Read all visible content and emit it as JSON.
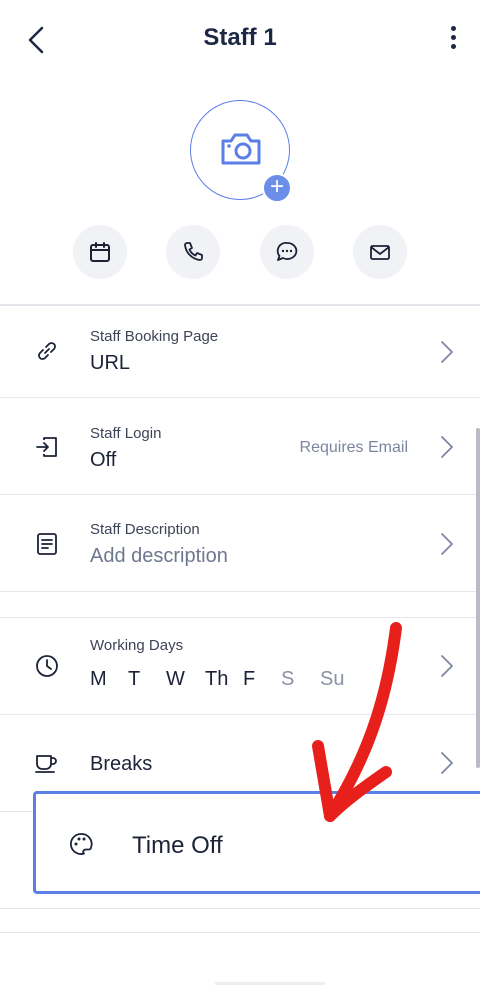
{
  "header": {
    "title": "Staff 1"
  },
  "avatar": {
    "add_symbol": "+"
  },
  "quick_actions": [
    "calendar-icon",
    "phone-icon",
    "chat-icon",
    "mail-icon"
  ],
  "rows": {
    "booking": {
      "label": "Staff Booking Page",
      "value": "URL"
    },
    "login": {
      "label": "Staff Login",
      "value": "Off",
      "hint": "Requires Email"
    },
    "description": {
      "label": "Staff Description",
      "placeholder": "Add description"
    },
    "working_days": {
      "label": "Working Days",
      "days": [
        {
          "name": "M",
          "active": true
        },
        {
          "name": "T",
          "active": true
        },
        {
          "name": "W",
          "active": true
        },
        {
          "name": "Th",
          "active": true
        },
        {
          "name": "F",
          "active": true
        },
        {
          "name": "S",
          "active": false
        },
        {
          "name": "Su",
          "active": false
        }
      ]
    },
    "breaks": {
      "label": "Breaks"
    },
    "time_off": {
      "label": "Time Off"
    }
  },
  "colors": {
    "accent": "#5b7fe6",
    "annotation": "#e8201c"
  }
}
